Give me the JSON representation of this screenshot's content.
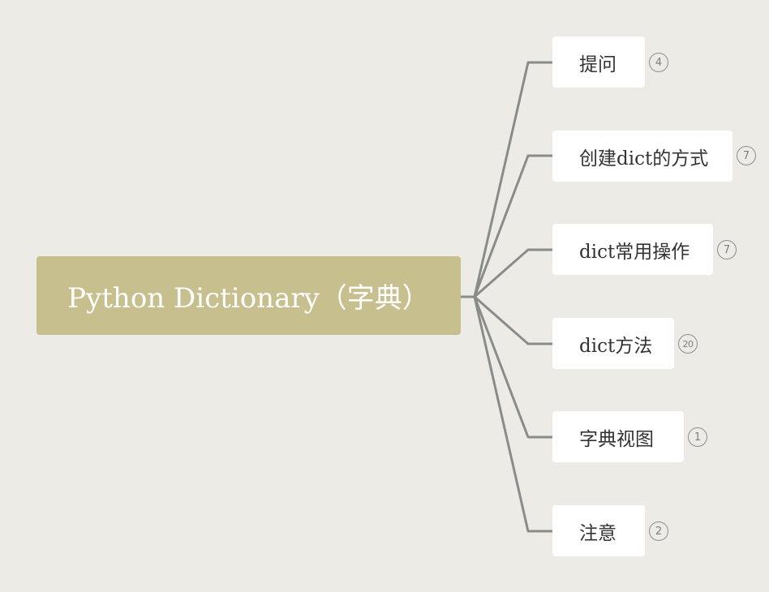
{
  "root": {
    "label": "Python Dictionary（字典）"
  },
  "topics": [
    {
      "label": "提问",
      "count": "4"
    },
    {
      "label": "创建dict的方式",
      "count": "7"
    },
    {
      "label": "dict常用操作",
      "count": "7"
    },
    {
      "label": "dict方法",
      "count": "20"
    },
    {
      "label": "字典视图",
      "count": "1"
    },
    {
      "label": "注意",
      "count": "2"
    }
  ],
  "colors": {
    "background": "#ecebe5",
    "root_fill": "#c8bf8f",
    "topic_fill": "#ffffff",
    "connector": "#8a8c8a"
  }
}
